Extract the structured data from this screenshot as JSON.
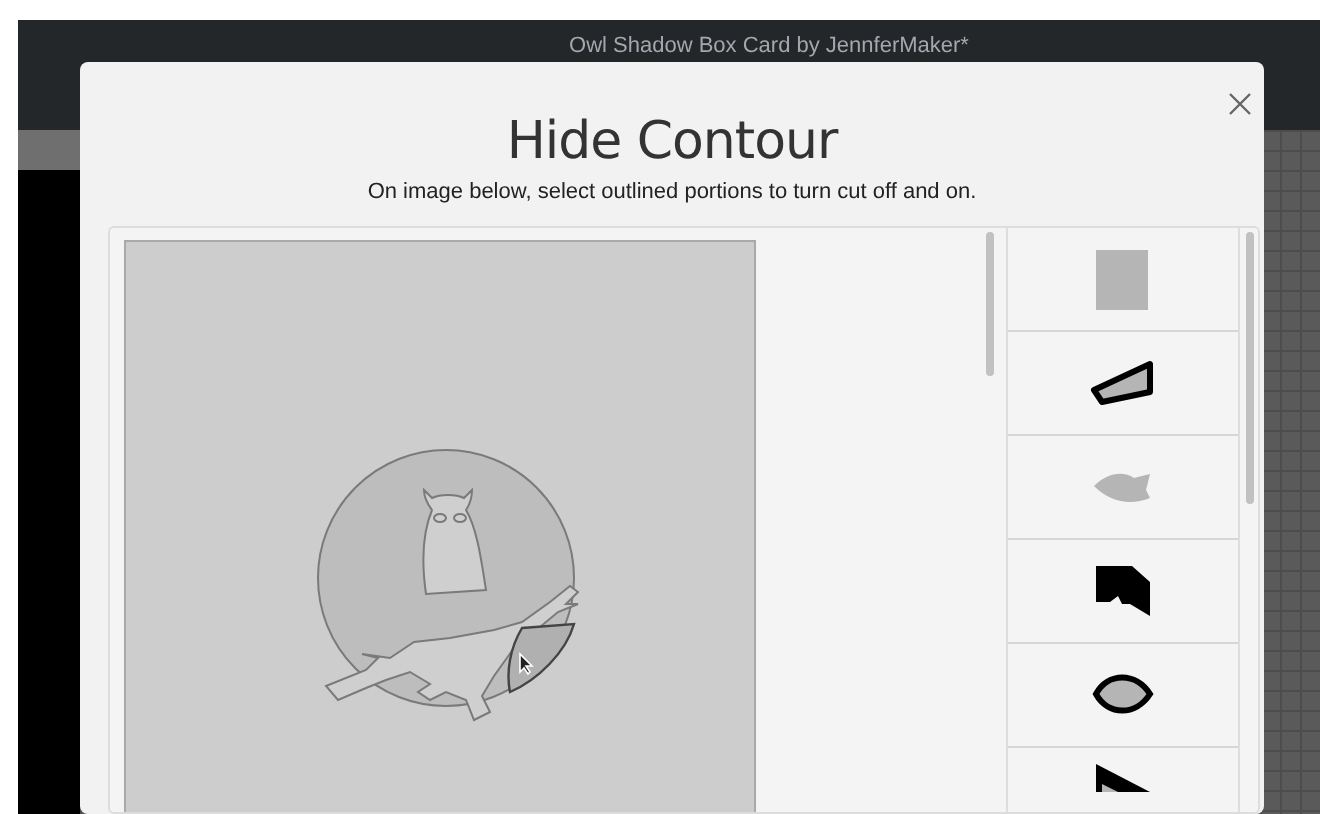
{
  "window": {
    "title": "Owl Shadow Box Card by JennferMaker*"
  },
  "dialog": {
    "title": "Hide Contour",
    "instructions": "On image below, select outlined portions to turn cut off and on."
  },
  "layers": [
    {
      "kind": "square"
    },
    {
      "kind": "wedge"
    },
    {
      "kind": "leaf"
    },
    {
      "kind": "block"
    },
    {
      "kind": "eye"
    },
    {
      "kind": "triangle"
    }
  ]
}
